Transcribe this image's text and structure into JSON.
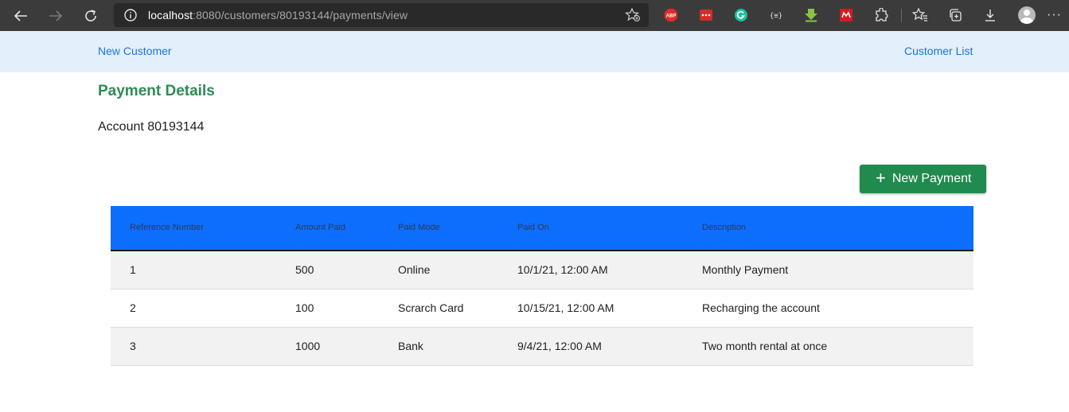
{
  "browser": {
    "url_host": "localhost",
    "url_rest": ":8080/customers/80193144/payments/view",
    "extensions": [
      {
        "name": "adblock-plus-icon",
        "label": "ABP",
        "color": "#e02b2b"
      },
      {
        "name": "lastpass-icon",
        "label": "•••",
        "color": "#d32d27"
      },
      {
        "name": "grammarly-icon",
        "label": "G",
        "color": "#15c39a"
      },
      {
        "name": "json-viewer-icon",
        "label": "{≡}",
        "color": "#3b3b3b"
      },
      {
        "name": "download-helper-icon",
        "label": "",
        "color": "#8bc34a"
      },
      {
        "name": "mendeley-icon",
        "label": "",
        "color": "#d71920"
      }
    ]
  },
  "nav": {
    "new_customer": "New Customer",
    "customer_list": "Customer List"
  },
  "page": {
    "title": "Payment Details",
    "account_label": "Account 80193144",
    "new_payment_plus": "+",
    "new_payment_label": "New Payment"
  },
  "table": {
    "headers": [
      "Reference Number",
      "Amount Paid",
      "Paid Mode",
      "Paid On",
      "Description"
    ],
    "rows": [
      [
        "1",
        "500",
        "Online",
        "10/1/21, 12:00 AM",
        "Monthly Payment"
      ],
      [
        "2",
        "100",
        "Scrarch Card",
        "10/15/21, 12:00 AM",
        "Recharging the account"
      ],
      [
        "3",
        "1000",
        "Bank",
        "9/4/21, 12:00 AM",
        "Two month rental at once"
      ]
    ]
  },
  "colors": {
    "title_green": "#2e8b57",
    "button_green": "#218a4e",
    "header_blue": "#0d6efd",
    "link_blue": "#1a73e8",
    "nav_bg": "#e3f0fb"
  }
}
